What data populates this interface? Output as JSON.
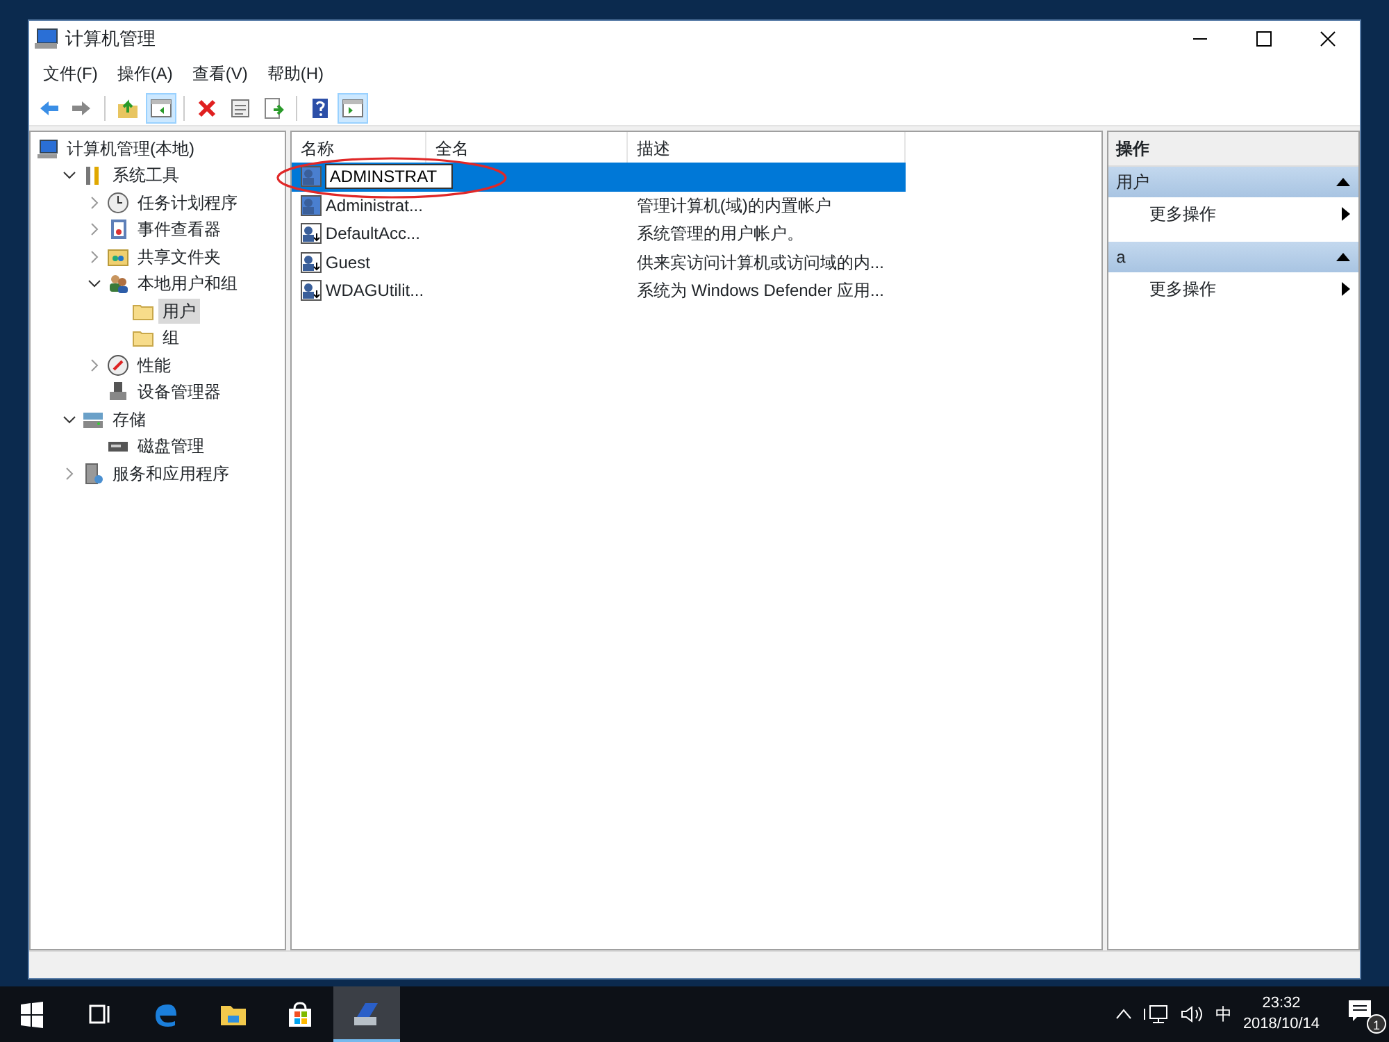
{
  "window": {
    "title": "计算机管理"
  },
  "menu": [
    "文件(F)",
    "操作(A)",
    "查看(V)",
    "帮助(H)"
  ],
  "toolbar": [
    {
      "kind": "back",
      "pressed": false
    },
    {
      "kind": "forward",
      "pressed": false
    },
    {
      "kind": "sep"
    },
    {
      "kind": "up",
      "pressed": false
    },
    {
      "kind": "tree",
      "pressed": true
    },
    {
      "kind": "sep"
    },
    {
      "kind": "delete",
      "pressed": false
    },
    {
      "kind": "properties",
      "pressed": false
    },
    {
      "kind": "export",
      "pressed": false
    },
    {
      "kind": "sep"
    },
    {
      "kind": "help",
      "pressed": false
    },
    {
      "kind": "actionpane",
      "pressed": true
    }
  ],
  "tree": [
    {
      "label": "计算机管理(本地)",
      "selected": false,
      "children": [
        {
          "label": "系统工具",
          "expanded": true,
          "selected": false,
          "children": [
            {
              "label": "任务计划程序",
              "expanded": false,
              "selected": false
            },
            {
              "label": "事件查看器",
              "expanded": false,
              "selected": false
            },
            {
              "label": "共享文件夹",
              "expanded": false,
              "selected": false
            },
            {
              "label": "本地用户和组",
              "expanded": true,
              "selected": false,
              "children": [
                {
                  "label": "用户",
                  "selected": true
                },
                {
                  "label": "组",
                  "selected": false
                }
              ]
            },
            {
              "label": "性能",
              "expanded": false,
              "selected": false
            },
            {
              "label": "设备管理器",
              "selected": false
            }
          ]
        },
        {
          "label": "存储",
          "expanded": true,
          "selected": false,
          "children": [
            {
              "label": "磁盘管理",
              "selected": false
            }
          ]
        },
        {
          "label": "服务和应用程序",
          "expanded": false,
          "selected": false
        }
      ]
    }
  ],
  "list": {
    "columns": [
      "名称",
      "全名",
      "描述"
    ],
    "rows": [
      {
        "name": "ADMINSTRAT",
        "description": "",
        "selected": true,
        "editing": true,
        "disabled": false
      },
      {
        "name": "Administrat...",
        "description": "管理计算机(域)的内置帐户",
        "selected": false,
        "editing": false,
        "disabled": false
      },
      {
        "name": "DefaultAcc...",
        "description": "系统管理的用户帐户。",
        "selected": false,
        "editing": false,
        "disabled": true
      },
      {
        "name": "Guest",
        "description": "供来宾访问计算机或访问域的内...",
        "selected": false,
        "editing": false,
        "disabled": true
      },
      {
        "name": "WDAGUtilit...",
        "description": "系统为 Windows Defender 应用...",
        "selected": false,
        "editing": false,
        "disabled": true
      }
    ]
  },
  "actions": {
    "title": "操作",
    "sections": [
      {
        "title": "用户",
        "expanded": true,
        "items": [
          "更多操作"
        ]
      },
      {
        "title": "a",
        "expanded": true,
        "items": [
          "更多操作"
        ]
      }
    ]
  },
  "taskbar": {
    "items": [
      {
        "kind": "start",
        "active": false
      },
      {
        "kind": "taskview",
        "active": false
      },
      {
        "kind": "edge",
        "active": false
      },
      {
        "kind": "explorer",
        "active": false
      },
      {
        "kind": "store",
        "active": false
      },
      {
        "kind": "compmgmt",
        "active": true
      }
    ],
    "ime": "中",
    "time": "23:32",
    "date": "2018/10/14",
    "notifications": "1"
  }
}
